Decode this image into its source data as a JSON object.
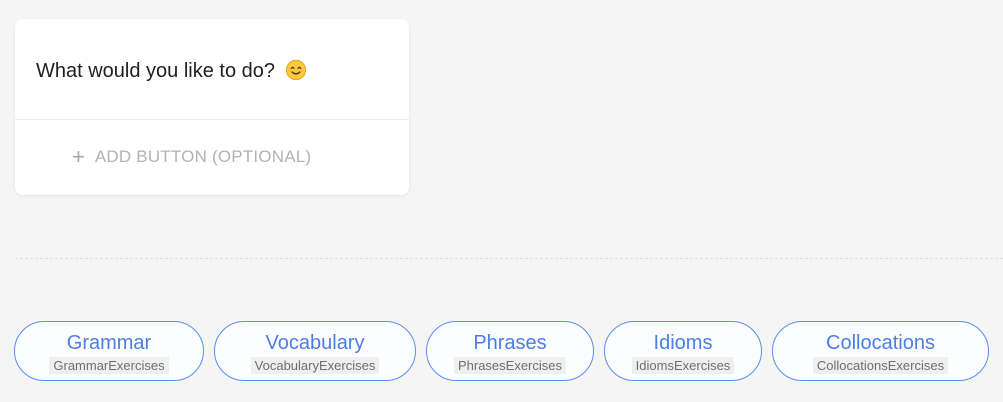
{
  "card": {
    "message": "What would you like to do?",
    "emoji": "smiling-face-icon",
    "add_button_label": "ADD BUTTON (OPTIONAL)"
  },
  "quick_replies": [
    {
      "label": "Grammar",
      "payload": "GrammarExercises"
    },
    {
      "label": "Vocabulary",
      "payload": "VocabularyExercises"
    },
    {
      "label": "Phrases",
      "payload": "PhrasesExercises"
    },
    {
      "label": "Idioms",
      "payload": "IdiomsExercises"
    },
    {
      "label": "Collocations",
      "payload": "CollocationsExercises"
    }
  ],
  "colors": {
    "accent": "#4a7ee6",
    "background": "#f5f5f5"
  }
}
